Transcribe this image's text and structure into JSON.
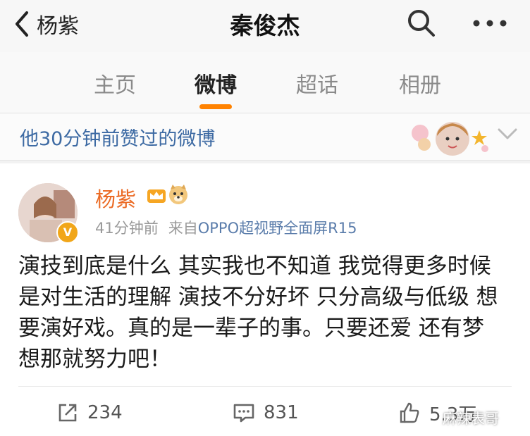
{
  "nav": {
    "back_label": "杨紫",
    "title": "秦俊杰"
  },
  "tabs": [
    {
      "label": "主页"
    },
    {
      "label": "微博"
    },
    {
      "label": "超话"
    },
    {
      "label": "相册"
    }
  ],
  "active_tab": "微博",
  "liked_notice": "他30分钟前赞过的微博",
  "post": {
    "author": "杨紫",
    "time": "41分钟前",
    "source_prefix": "来自",
    "source": "OPPO超视野全面屏R15",
    "content": "演技到底是什么 其实我也不知道 我觉得更多时候是对生活的理解 演技不分好坏 只分高级与低级 想要演好戏。真的是一辈子的事。只要还爱 还有梦想那就努力吧！",
    "reposts": "234",
    "comments": "831",
    "likes": "5.3万"
  },
  "watermark": "麻辣表哥",
  "colors": {
    "accent": "#ff8200",
    "username": "#eb6b25",
    "link": "#3d6aa3"
  },
  "icons": [
    "back-chevron-icon",
    "search-icon",
    "more-icon",
    "chevron-down-icon",
    "crown-icon",
    "doge-icon",
    "repost-icon",
    "comment-icon",
    "like-icon"
  ]
}
